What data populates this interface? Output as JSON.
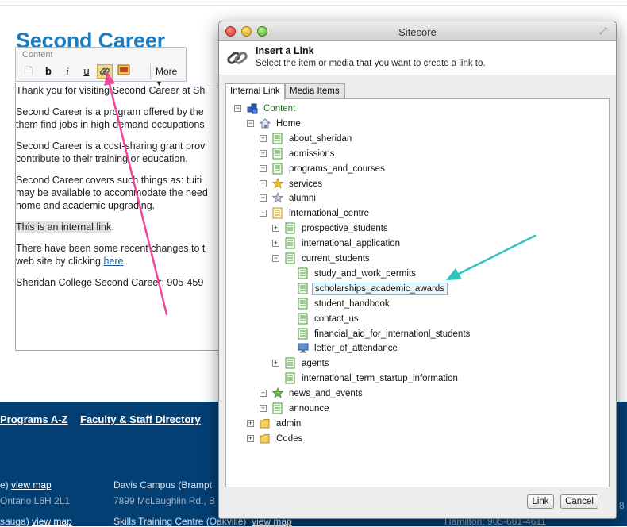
{
  "background": {
    "page_title": "Second Career",
    "toolbar": {
      "label": "Content",
      "more_label": "More",
      "buttons": [
        {
          "name": "document-icon",
          "glyph": "🗋"
        },
        {
          "name": "bold-button",
          "glyph": "b"
        },
        {
          "name": "italic-button",
          "glyph": "i"
        },
        {
          "name": "underline-button",
          "glyph": "u"
        },
        {
          "name": "link-icon",
          "glyph": "🔗"
        },
        {
          "name": "image-icon",
          "glyph": "▣"
        }
      ]
    },
    "editor": {
      "p1": "Thank you for visiting Second Career at Sh",
      "p2a": "Second Career is a program offered by the",
      "p2b": "them find jobs in high-demand occupations",
      "p3a": "Second Career is a cost-sharing grant prov",
      "p3b": "contribute to their training or education.",
      "p4a": "Second Career covers such things as:  tuiti",
      "p4b": "may be available to accommodate the need",
      "p4c": "home and academic upgrading.",
      "p5_highlight": "This is an internal link",
      "p5_end": ".",
      "p6a": "There have been some recent changes to t",
      "p6b_prefix": "web site by clicking  ",
      "p6b_link": "here",
      "p6b_end": ".",
      "p7": "Sheridan College Second Career:  905-459"
    },
    "footer": {
      "links": [
        "Programs A-Z",
        "Faculty & Staff Directory"
      ],
      "row1_left_prefix": "e)  ",
      "row1_left_link": "view map",
      "row1_right": "Davis Campus (Brampt",
      "row2_left": "Ontario L6H 2L1",
      "row2_right": "7899 McLaughlin Rd., B",
      "row3_left_prefix": "sauga)  ",
      "row3_left_link": "view map",
      "row3_right": "Skills Training Centre (Oakville)",
      "row3_right_link": "view map",
      "row3_far": "Hamilton: 905-681-4611",
      "right_edge_text": "8"
    }
  },
  "dialog": {
    "window_title": "Sitecore",
    "header_title": "Insert a Link",
    "header_subtitle": "Select the item or media that you want to create a link to.",
    "tabs": [
      "Internal Link",
      "Media Items"
    ],
    "active_tab": "Internal Link",
    "tree": [
      {
        "id": "content",
        "label": "Content",
        "depth": 0,
        "expander": "minus",
        "icon": "content",
        "color": "#1f6f1f"
      },
      {
        "id": "home",
        "label": "Home",
        "depth": 1,
        "expander": "minus",
        "icon": "home"
      },
      {
        "id": "about_sheridan",
        "label": "about_sheridan",
        "depth": 2,
        "expander": "plus",
        "icon": "page"
      },
      {
        "id": "admissions",
        "label": "admissions",
        "depth": 2,
        "expander": "plus",
        "icon": "page"
      },
      {
        "id": "programs_and_courses",
        "label": "programs_and_courses",
        "depth": 2,
        "expander": "plus",
        "icon": "page"
      },
      {
        "id": "services",
        "label": "services",
        "depth": 2,
        "expander": "plus",
        "icon": "star-gold"
      },
      {
        "id": "alumni",
        "label": "alumni",
        "depth": 2,
        "expander": "plus",
        "icon": "star-gray"
      },
      {
        "id": "international_centre",
        "label": "international_centre",
        "depth": 2,
        "expander": "minus",
        "icon": "page-yellow"
      },
      {
        "id": "prospective_students",
        "label": "prospective_students",
        "depth": 3,
        "expander": "plus",
        "icon": "page"
      },
      {
        "id": "international_application",
        "label": "international_application",
        "depth": 3,
        "expander": "plus",
        "icon": "page"
      },
      {
        "id": "current_students",
        "label": "current_students",
        "depth": 3,
        "expander": "minus",
        "icon": "page"
      },
      {
        "id": "study_and_work_permits",
        "label": "study_and_work_permits",
        "depth": 4,
        "expander": "none",
        "icon": "page"
      },
      {
        "id": "scholarships_academic_awards",
        "label": "scholarships_academic_awards",
        "depth": 4,
        "expander": "none",
        "icon": "page",
        "selected": true
      },
      {
        "id": "student_handbook",
        "label": "student_handbook",
        "depth": 4,
        "expander": "none",
        "icon": "page"
      },
      {
        "id": "contact_us",
        "label": "contact_us",
        "depth": 4,
        "expander": "none",
        "icon": "page"
      },
      {
        "id": "financial_aid",
        "label": "financial_aid_for_internationl_students",
        "depth": 4,
        "expander": "none",
        "icon": "page"
      },
      {
        "id": "letter_of_attendance",
        "label": "letter_of_attendance",
        "depth": 4,
        "expander": "none",
        "icon": "monitor"
      },
      {
        "id": "agents",
        "label": "agents",
        "depth": 3,
        "expander": "plus",
        "icon": "page"
      },
      {
        "id": "international_term_startup_information",
        "label": "international_term_startup_information",
        "depth": 3,
        "expander": "none",
        "icon": "page"
      },
      {
        "id": "news_and_events",
        "label": "news_and_events",
        "depth": 2,
        "expander": "plus",
        "icon": "star-green"
      },
      {
        "id": "announce",
        "label": "announce",
        "depth": 2,
        "expander": "plus",
        "icon": "page"
      },
      {
        "id": "admin",
        "label": "admin",
        "depth": 1,
        "expander": "plus",
        "icon": "folder"
      },
      {
        "id": "codes",
        "label": "Codes",
        "depth": 1,
        "expander": "plus",
        "icon": "folder"
      }
    ],
    "buttons": {
      "link": "Link",
      "cancel": "Cancel"
    }
  },
  "colors": {
    "brand_blue": "#1a7cc1",
    "footer_navy": "#043f73",
    "annotation_pink": "#f0479a",
    "annotation_teal": "#2fc4c0",
    "tree_content_green": "#1f6f1f"
  }
}
